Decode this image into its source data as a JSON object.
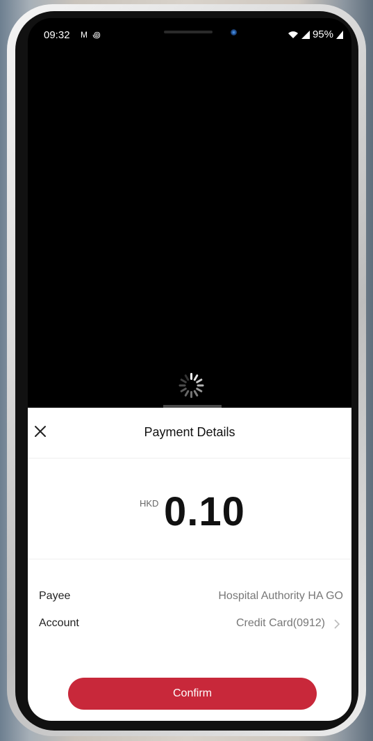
{
  "status_bar": {
    "time": "09:32",
    "notifications": "M ꩜",
    "battery": "95%"
  },
  "sheet": {
    "title": "Payment Details",
    "close_icon": "close-icon"
  },
  "payment": {
    "currency": "HKD",
    "amount": "0.10"
  },
  "details": {
    "payee_label": "Payee",
    "payee_value": "Hospital Authority HA GO",
    "account_label": "Account",
    "account_value": "Credit Card(0912)"
  },
  "actions": {
    "confirm_label": "Confirm"
  },
  "colors": {
    "confirm_button": "#c8283a",
    "screen_background": "#000000",
    "sheet_background": "#ffffff"
  }
}
